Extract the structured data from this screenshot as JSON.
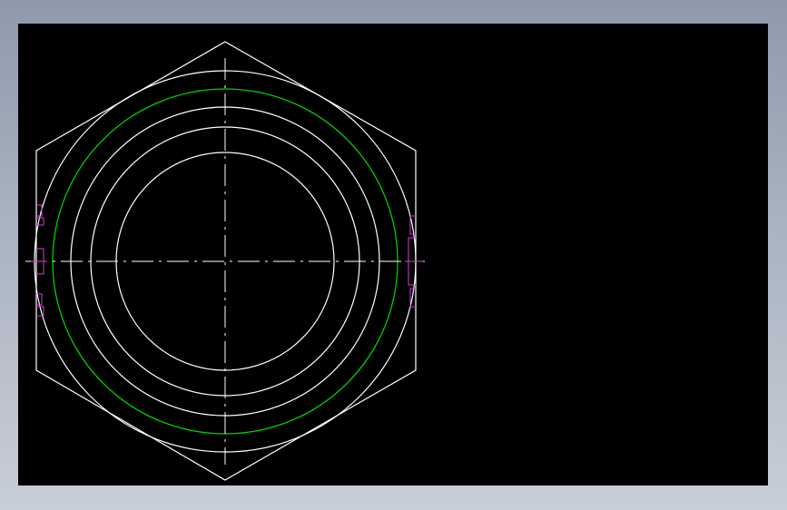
{
  "drawing": {
    "title": "",
    "background_color": "#000000",
    "frame_gradient": [
      "#8e9aab",
      "#c8ced7"
    ],
    "colors": {
      "outline": "#ffffff",
      "pitch_circle": "#00d000",
      "center_line": "#ffffff",
      "annotation_marks": "#d040d0"
    },
    "entities": [
      {
        "name": "hexagon-outline",
        "kind": "hexagon",
        "color_key": "outline"
      },
      {
        "name": "chamfer-circle",
        "kind": "circle",
        "color_key": "outline"
      },
      {
        "name": "thread-major-circle",
        "kind": "circle",
        "color_key": "pitch_circle"
      },
      {
        "name": "inner-circle-1",
        "kind": "circle",
        "color_key": "outline"
      },
      {
        "name": "inner-circle-2",
        "kind": "circle",
        "color_key": "outline"
      },
      {
        "name": "bore-circle",
        "kind": "circle",
        "color_key": "outline"
      },
      {
        "name": "horizontal-center-line",
        "kind": "dash-dot",
        "color_key": "center_line"
      },
      {
        "name": "vertical-center-line",
        "kind": "dash-dot",
        "color_key": "center_line"
      },
      {
        "name": "left-side-marks",
        "kind": "marks",
        "color_key": "annotation_marks"
      },
      {
        "name": "right-side-marks",
        "kind": "marks",
        "color_key": "annotation_marks"
      }
    ]
  }
}
